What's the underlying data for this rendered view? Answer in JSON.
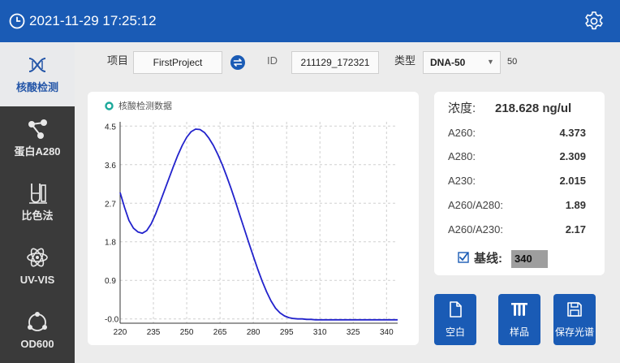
{
  "header": {
    "datetime": "2021-11-29 17:25:12"
  },
  "sidebar": {
    "items": [
      {
        "label": "核酸检测",
        "active": true,
        "icon": "dna-icon"
      },
      {
        "label": "蛋白A280",
        "active": false,
        "icon": "molecule-icon"
      },
      {
        "label": "比色法",
        "active": false,
        "icon": "cuvette-icon"
      },
      {
        "label": "UV-VIS",
        "active": false,
        "icon": "atom-icon"
      },
      {
        "label": "OD600",
        "active": false,
        "icon": "cell-icon"
      }
    ]
  },
  "params": {
    "project_label": "项目",
    "project_value": "FirstProject",
    "id_label": "ID",
    "id_value": "211129_172321",
    "type_label": "类型",
    "type_value": "DNA-50",
    "type_factor": "50"
  },
  "results": {
    "title": "浓度:",
    "concentration": "218.628 ng/ul",
    "rows": [
      {
        "label": "A260:",
        "value": "4.373"
      },
      {
        "label": "A280:",
        "value": "2.309"
      },
      {
        "label": "A230:",
        "value": "2.015"
      },
      {
        "label": "A260/A280:",
        "value": "1.89"
      },
      {
        "label": "A260/A230:",
        "value": "2.17"
      }
    ],
    "baseline_label": "基线:",
    "baseline_value": "340",
    "baseline_checked": true
  },
  "actions": {
    "blank": "空白",
    "sample": "样品",
    "save": "保存光谱"
  },
  "colors": {
    "primary": "#1a5bb5",
    "curve": "#2222cc",
    "legend": "#1aa89a",
    "sidebar": "#3a3a3a"
  },
  "chart_data": {
    "type": "line",
    "title": "核酸检测数据",
    "series": [
      {
        "name": "核酸检测数据",
        "x": [
          220,
          222,
          224,
          226,
          228,
          230,
          232,
          234,
          236,
          238,
          240,
          242,
          244,
          246,
          248,
          250,
          252,
          254,
          256,
          258,
          260,
          262,
          264,
          266,
          268,
          270,
          272,
          274,
          276,
          278,
          280,
          282,
          284,
          286,
          288,
          290,
          292,
          294,
          296,
          298,
          300,
          302,
          304,
          306,
          308,
          310,
          315,
          320,
          325,
          330,
          335,
          340,
          345
        ],
        "y": [
          2.95,
          2.6,
          2.3,
          2.12,
          2.03,
          2.0,
          2.06,
          2.22,
          2.45,
          2.72,
          3.0,
          3.28,
          3.56,
          3.82,
          4.05,
          4.24,
          4.37,
          4.43,
          4.42,
          4.35,
          4.22,
          4.05,
          3.84,
          3.6,
          3.33,
          3.04,
          2.73,
          2.41,
          2.09,
          1.77,
          1.46,
          1.16,
          0.88,
          0.63,
          0.42,
          0.25,
          0.14,
          0.07,
          0.03,
          0.01,
          0.0,
          0.0,
          -0.01,
          -0.01,
          -0.02,
          -0.02,
          -0.02,
          -0.02,
          -0.02,
          -0.02,
          -0.02,
          -0.02,
          -0.02
        ]
      }
    ],
    "xticks": [
      220,
      235,
      250,
      265,
      280,
      295,
      310,
      325,
      340
    ],
    "yticks": [
      "-0.0",
      "0.9",
      "1.8",
      "2.7",
      "3.6",
      "4.5"
    ],
    "xlim": [
      220,
      345
    ],
    "ylim": [
      -0.1,
      4.6
    ],
    "grid": true,
    "legend": "top-left"
  }
}
